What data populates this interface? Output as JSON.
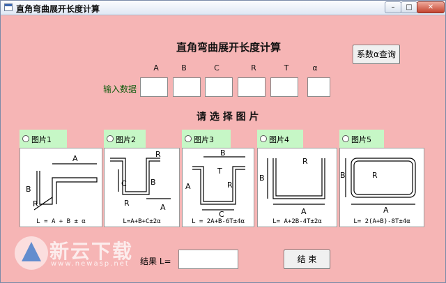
{
  "window": {
    "title": "直角弯曲展开长度计算"
  },
  "titlebar": {
    "min": "–",
    "max": "□",
    "close": "✕"
  },
  "main_heading": "直角弯曲展开长度计算",
  "coef_button": "系数α查询",
  "input": {
    "label": "输入数据",
    "columns": [
      "A",
      "B",
      "C",
      "R",
      "T",
      "α"
    ]
  },
  "choose_heading": "请 选 择 图 片",
  "figures": [
    {
      "label": "图片1",
      "formula": "L = A + B ± α"
    },
    {
      "label": "图片2",
      "formula": "L=A+B+C±2α"
    },
    {
      "label": "图片3",
      "formula": "L = 2A+B-6T±4α"
    },
    {
      "label": "图片4",
      "formula": "L= A+2B-4T±2α"
    },
    {
      "label": "图片5",
      "formula": "L= 2(A+B)-8T±4α"
    }
  ],
  "result": {
    "label": "结果 L=",
    "value": ""
  },
  "end_button": "结 束",
  "watermark": {
    "text": "新云下载",
    "url": "www.newasp.net"
  },
  "icons": [
    "app-icon",
    "minimize-icon",
    "maximize-icon",
    "close-icon",
    "radio-icon",
    "watermark-logo-icon"
  ]
}
